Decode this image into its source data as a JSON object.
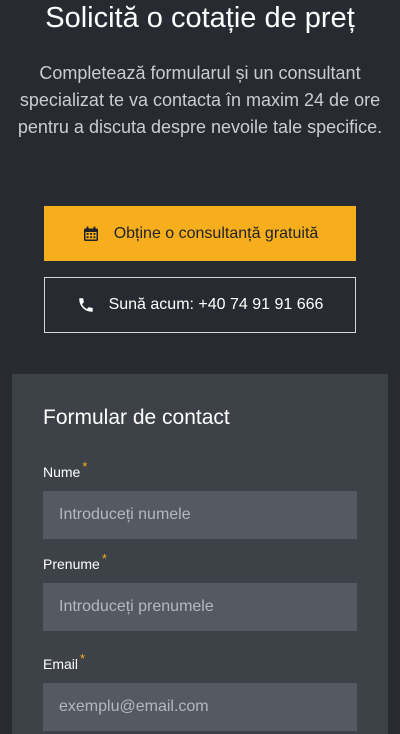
{
  "hero": {
    "title": "Solicită o cotație de preț",
    "description": "Completează formularul și un consultant specializat te va contacta în maxim 24 de ore pentru a discuta despre nevoile tale specifice."
  },
  "buttons": {
    "consult": {
      "label": "Obține o consultanță gratuită",
      "icon": "calendar-icon"
    },
    "call": {
      "label": "Sună acum: +40 74 91 91 666",
      "icon": "phone-icon"
    }
  },
  "colors": {
    "accent": "#f6ae1d",
    "background": "#272b31",
    "card": "#3d4148",
    "input": "#555a62"
  },
  "form": {
    "title": "Formular de contact",
    "required_mark": "*",
    "fields": [
      {
        "label": "Nume",
        "placeholder": "Introduceți numele"
      },
      {
        "label": "Prenume",
        "placeholder": "Introduceți prenumele"
      },
      {
        "label": "Email",
        "placeholder": "exemplu@email.com"
      }
    ]
  }
}
